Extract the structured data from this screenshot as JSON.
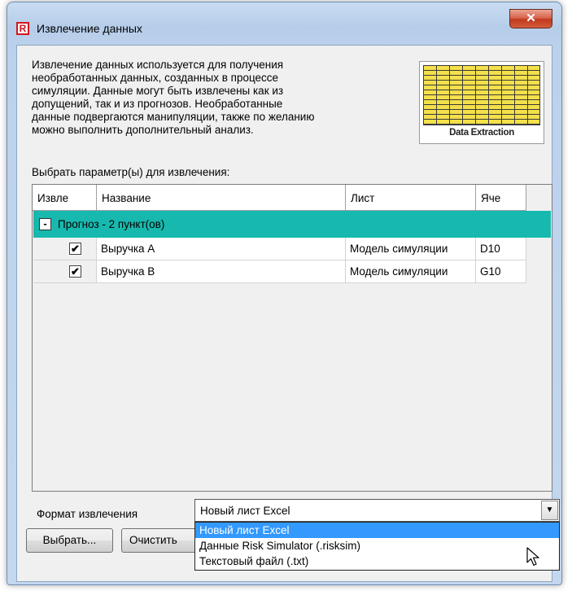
{
  "window": {
    "title": "Извлечение данных",
    "app_icon_letter": "R",
    "close_glyph": "✕"
  },
  "description": "Извлечение данных используется для получения\nнеобработанных данных, созданных в процессе\nсимуляции. Данные могут быть извлечены как из\nдопущений, так и из прогнозов. Необработанные\nданные подвергаются манипуляции, также по желанию\nможно выполнить дополнительный анализ.",
  "thumbnail": {
    "caption": "Data Extraction"
  },
  "select_label": "Выбрать параметр(ы) для извлечения:",
  "grid": {
    "columns": [
      "Извле",
      "Название",
      "Лист",
      "Яче"
    ],
    "group": {
      "toggle": "-",
      "label": "Прогноз - 2 пункт(ов)"
    },
    "rows": [
      {
        "checked": "✔",
        "name": "Выручка A",
        "sheet": "Модель симуляции",
        "cell": "D10"
      },
      {
        "checked": "✔",
        "name": "Выручка B",
        "sheet": "Модель симуляции",
        "cell": "G10"
      }
    ]
  },
  "format": {
    "label": "Формат извлечения",
    "selected": "Новый лист Excel",
    "arrow_glyph": "▼",
    "options": [
      "Новый лист Excel",
      "Данные Risk Simulator (.risksim)",
      "Текстовый файл (.txt)"
    ]
  },
  "buttons": {
    "select": "Выбрать...",
    "clear": "Очистить"
  },
  "colors": {
    "group_row": "#17b9ae",
    "highlight": "#3399ff"
  }
}
